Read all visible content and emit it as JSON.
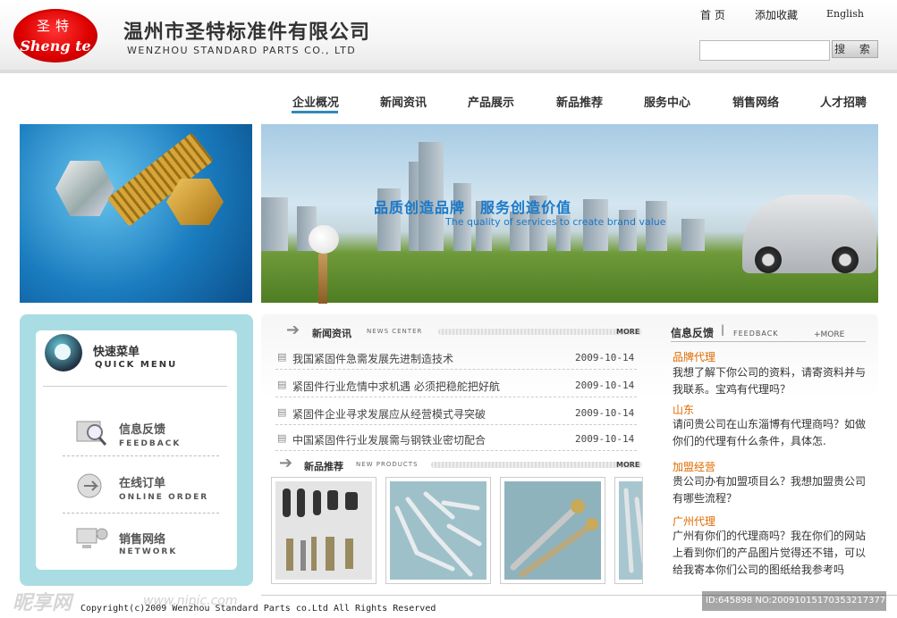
{
  "header": {
    "logo_top": "圣特",
    "logo_script": "Sheng te",
    "company_cn": "温州市圣特标准件有限公司",
    "company_en": "WENZHOU STANDARD PARTS CO., LTD",
    "links": [
      "首 页",
      "添加收藏",
      "English"
    ],
    "search_placeholder": "",
    "search_button": "搜 索"
  },
  "nav": {
    "items": [
      "企业概况",
      "新闻资讯",
      "产品展示",
      "新品推荐",
      "服务中心",
      "销售网络",
      "人才招聘"
    ],
    "active_index": 0,
    "active_color": "#2e8bb8"
  },
  "banner": {
    "slogan_cn": "品质创造品牌　服务创造价值",
    "slogan_en": "The quality of services to create brand value"
  },
  "quick_menu": {
    "title_cn": "快速菜单",
    "title_en": "QUICK MENU",
    "items": [
      {
        "cn": "信息反馈",
        "en": "FEEDBACK",
        "icon": "magnifier-folder-icon"
      },
      {
        "cn": "在线订单",
        "en": "ONLINE ORDER",
        "icon": "globe-arrow-icon"
      },
      {
        "cn": "销售网络",
        "en": "NETWORK",
        "icon": "network-computer-icon"
      }
    ]
  },
  "news": {
    "title": "新闻资讯",
    "title_en": "NEWS CENTER",
    "more": "MORE",
    "items": [
      {
        "title": "我国紧固件急需发展先进制造技术",
        "date": "2009-10-14"
      },
      {
        "title": "紧固件行业危情中求机遇 必须把稳舵把好航",
        "date": "2009-10-14"
      },
      {
        "title": "紧固件企业寻求发展应从经营模式寻突破",
        "date": "2009-10-14"
      },
      {
        "title": "中国紧固件行业发展需与钢铁业密切配合",
        "date": "2009-10-14"
      }
    ]
  },
  "products": {
    "title": "新品推荐",
    "title_en": "NEW PRODUCTS",
    "more": "MORE"
  },
  "feedback": {
    "title": "信息反馈",
    "sep": "|",
    "title_en": "FEEDBACK",
    "more": "+MORE",
    "items": [
      {
        "head": "品牌代理",
        "text": "我想了解下你公司的资料，请寄资料并与我联系。宝鸡有代理吗？"
      },
      {
        "head": "山东",
        "text": "请问贵公司在山东淄博有代理商吗？如做你们的代理有什么条件，具体怎."
      },
      {
        "head": "加盟经营",
        "text": "贵公司办有加盟项目么？我想加盟贵公司有哪些流程？"
      },
      {
        "head": "广州代理",
        "text": "广州有你们的代理商吗？我在你们的网站上看到你们的产品图片觉得还不错，可以给我寄本你们公司的图纸给我参考吗"
      }
    ]
  },
  "footer": {
    "copyright": "Copyright(c)2009 Wenzhou Standard Parts co.Ltd All Rights Reserved"
  },
  "watermark": {
    "logo": "昵享网",
    "url": "www.nipic.com",
    "id_text": "ID:645898 NO:20091015170353217377"
  }
}
